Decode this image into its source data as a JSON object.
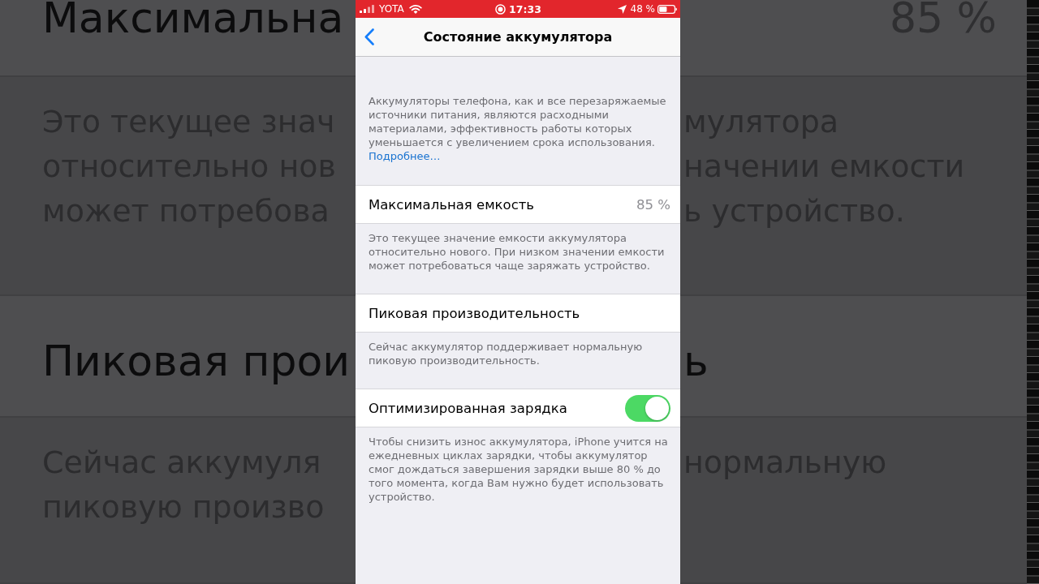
{
  "backdrop": {
    "bands": [
      {
        "kind": "cell",
        "left": "Максимальна",
        "value": "85 %"
      },
      {
        "kind": "note",
        "lines": [
          {
            "left": "Это текущее знач",
            "right": "мулятора"
          },
          {
            "left": "относительно нов",
            "right": "начении емкости"
          },
          {
            "left": "может потребова",
            "right": "ь устройство."
          }
        ]
      },
      {
        "kind": "cell",
        "left": "Пиковая прои",
        "right": "ь"
      },
      {
        "kind": "note",
        "lines": [
          {
            "left": "Сейчас аккумуля",
            "right": "нормальную"
          },
          {
            "left": "пиковую произво"
          }
        ]
      }
    ]
  },
  "status_bar": {
    "carrier": "YOTA",
    "time": "17:33",
    "battery": "48 %"
  },
  "nav": {
    "title": "Состояние аккумулятора"
  },
  "intro": {
    "text": "Аккумуляторы телефона, как и все перезаряжаемые источники питания, являются расходными материалами, эффективность работы которых уменьшается с увеличением срока использования.",
    "link": "Подробнее…"
  },
  "sections": [
    {
      "kind": "value",
      "label": "Максимальная емкость",
      "value": "85 %",
      "footer": "Это текущее значение емкости аккумулятора относительно нового. При низком значении емкости может потребоваться чаще заряжать устройство."
    },
    {
      "kind": "plain",
      "label": "Пиковая производительность",
      "footer": "Сейчас аккумулятор поддерживает нормальную пиковую производительность."
    },
    {
      "kind": "toggle",
      "label": "Оптимизированная зарядка",
      "on": true,
      "footer": "Чтобы снизить износ аккумулятора, iPhone учится на ежедневных циклах зарядки, чтобы аккумулятор смог дождаться завершения зарядки выше 80 % до того момента, когда Вам нужно будет использовать устройство."
    }
  ]
}
